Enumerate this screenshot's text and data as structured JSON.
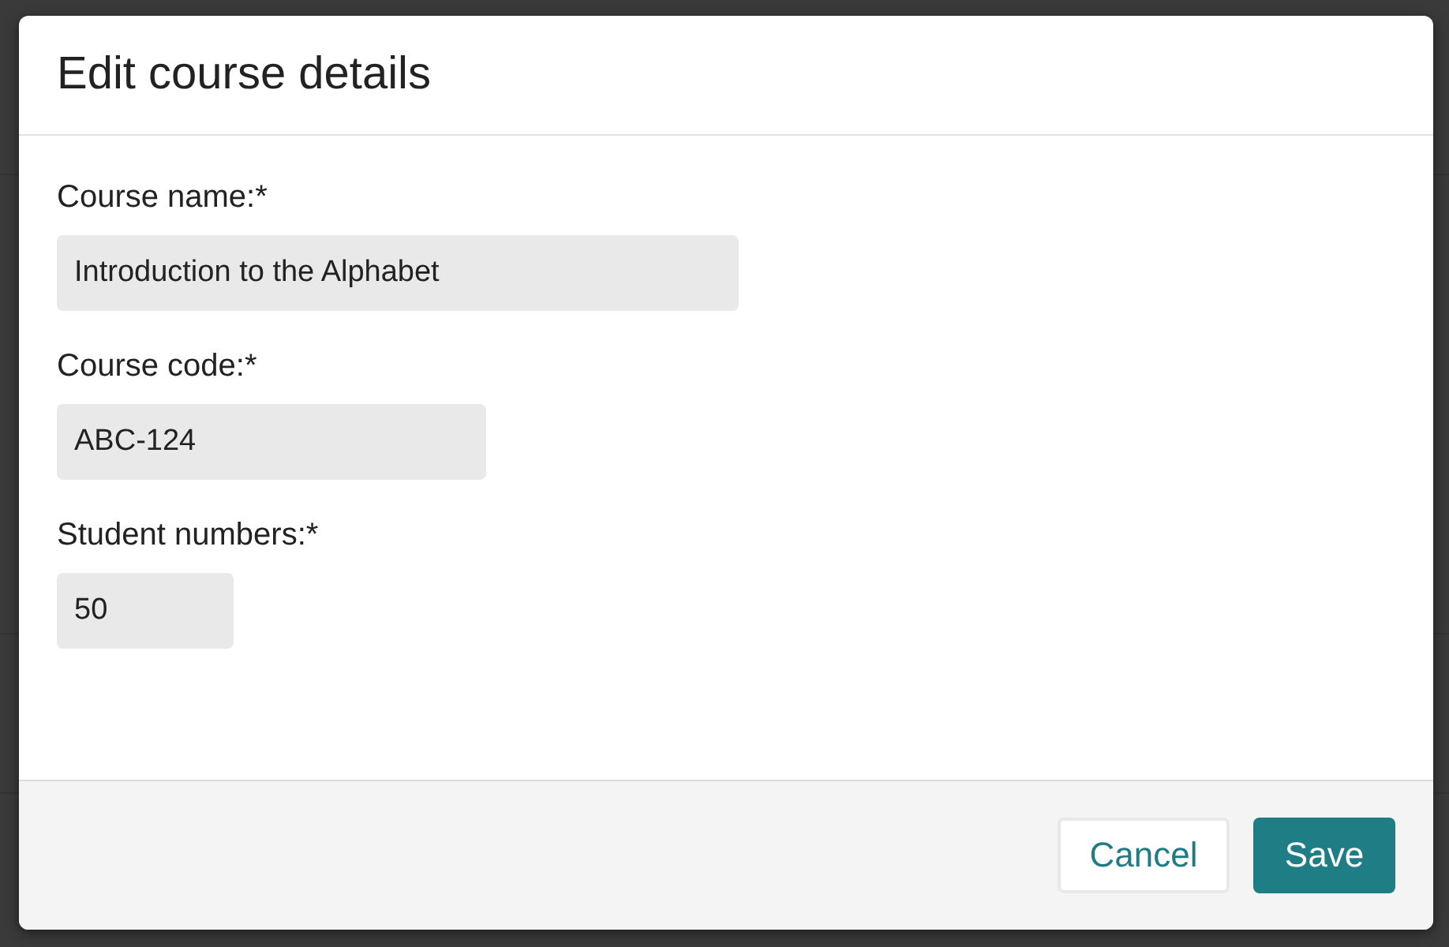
{
  "dialog": {
    "title": "Edit course details",
    "fields": [
      {
        "label": "Course name:*",
        "value": "Introduction to the Alphabet"
      },
      {
        "label": "Course code:*",
        "value": "ABC-124"
      },
      {
        "label": "Student numbers:*",
        "value": "50"
      }
    ],
    "buttons": [
      {
        "label": "Cancel",
        "kind": "secondary"
      },
      {
        "label": "Save",
        "kind": "primary"
      }
    ]
  }
}
